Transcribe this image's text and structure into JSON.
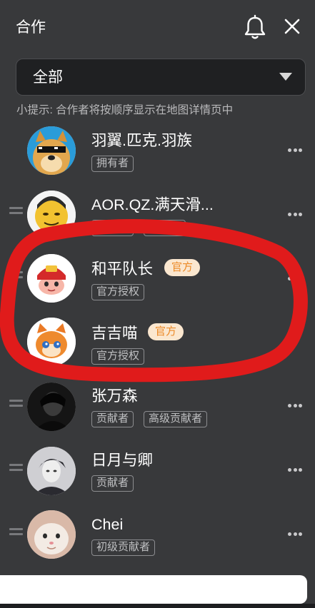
{
  "header": {
    "title": "合作",
    "bell_icon": "bell-icon",
    "close_icon": "close-icon"
  },
  "filter": {
    "selected": "全部",
    "caret_icon": "caret-down-icon"
  },
  "tip": "小提示: 合作者将按顺序显示在地图详情页中",
  "members": [
    {
      "name": "羽翼.匹克.羽族",
      "official": "",
      "tags": [
        "拥有者"
      ],
      "draggable": false,
      "avatar": "doge-sunglasses-avatar"
    },
    {
      "name": "AOR.QZ.满天滑...",
      "official": "",
      "tags": [
        "贡献者",
        "模型师"
      ],
      "draggable": true,
      "avatar": "yellow-smiley-avatar"
    },
    {
      "name": "和平队长",
      "official": "官方",
      "tags": [
        "官方授权"
      ],
      "draggable": true,
      "avatar": "red-mascot-avatar"
    },
    {
      "name": "吉吉喵",
      "official": "官方",
      "tags": [
        "官方授权"
      ],
      "draggable": false,
      "avatar": "orange-cat-avatar"
    },
    {
      "name": "张万森",
      "official": "",
      "tags": [
        "贡献者",
        "高级贡献者"
      ],
      "draggable": true,
      "avatar": "dark-portrait-avatar"
    },
    {
      "name": "日月与卿",
      "official": "",
      "tags": [
        "贡献者"
      ],
      "draggable": true,
      "avatar": "anime-portrait-avatar"
    },
    {
      "name": "Chei",
      "official": "",
      "tags": [
        "初级贡献者"
      ],
      "draggable": true,
      "avatar": "cat-face-avatar"
    }
  ],
  "more_icon": "more-dots-icon",
  "drag_icon": "drag-handle-icon",
  "annotation_color": "#e01b1b",
  "official_colors": {
    "background": "#fbe7cf",
    "text": "#ec8a27"
  }
}
